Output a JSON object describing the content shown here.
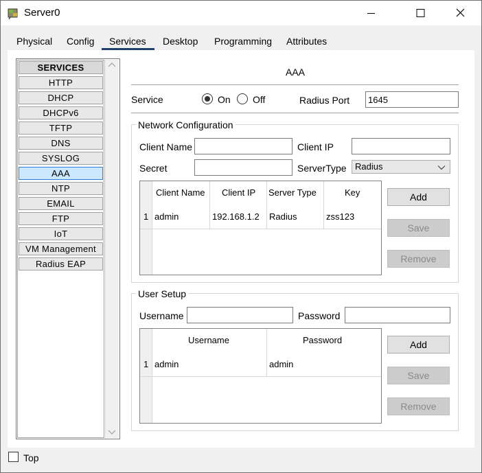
{
  "window": {
    "title": "Server0",
    "controls": {
      "minimize": "—",
      "maximize": "☐",
      "close": "✕"
    }
  },
  "tabs": [
    {
      "label": "Physical"
    },
    {
      "label": "Config"
    },
    {
      "label": "Services",
      "active": true
    },
    {
      "label": "Desktop"
    },
    {
      "label": "Programming"
    },
    {
      "label": "Attributes"
    }
  ],
  "sidebar": {
    "header": "SERVICES",
    "items": [
      {
        "label": "HTTP"
      },
      {
        "label": "DHCP"
      },
      {
        "label": "DHCPv6"
      },
      {
        "label": "TFTP"
      },
      {
        "label": "DNS"
      },
      {
        "label": "SYSLOG"
      },
      {
        "label": "AAA",
        "selected": true
      },
      {
        "label": "NTP"
      },
      {
        "label": "EMAIL"
      },
      {
        "label": "FTP"
      },
      {
        "label": "IoT"
      },
      {
        "label": "VM Management"
      },
      {
        "label": "Radius EAP"
      }
    ]
  },
  "aaa": {
    "heading": "AAA",
    "service_label": "Service",
    "on_label": "On",
    "off_label": "Off",
    "service_state": "On",
    "radius_port_label": "Radius Port",
    "radius_port_value": "1645",
    "network_config": {
      "title": "Network Configuration",
      "client_name_label": "Client Name",
      "client_name_value": "",
      "client_ip_label": "Client IP",
      "client_ip_value": "",
      "secret_label": "Secret",
      "secret_value": "",
      "server_type_label": "ServerType",
      "server_type_value": "Radius",
      "columns": [
        "Client Name",
        "Client IP",
        "Server Type",
        "Key"
      ],
      "rows": [
        {
          "index": "1",
          "client_name": "admin",
          "client_ip": "192.168.1.2",
          "server_type": "Radius",
          "key": "zss123"
        }
      ],
      "buttons": {
        "add": "Add",
        "save": "Save",
        "remove": "Remove"
      }
    },
    "user_setup": {
      "title": "User Setup",
      "username_label": "Username",
      "username_value": "",
      "password_label": "Password",
      "password_value": "",
      "columns": [
        "Username",
        "Password"
      ],
      "rows": [
        {
          "index": "1",
          "username": "admin",
          "password": "admin"
        }
      ],
      "buttons": {
        "add": "Add",
        "save": "Save",
        "remove": "Remove"
      }
    }
  },
  "footer": {
    "top_label": "Top",
    "top_checked": false
  }
}
